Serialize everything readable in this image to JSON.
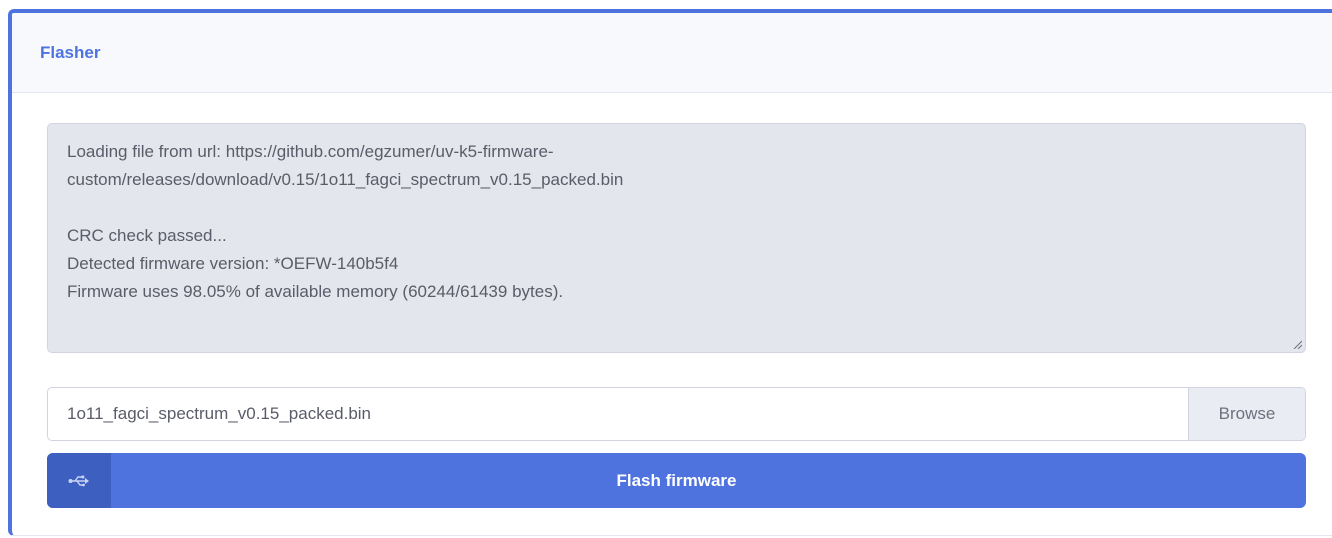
{
  "card": {
    "title": "Flasher"
  },
  "log": {
    "lines": [
      "Loading file from url: https://github.com/egzumer/uv-k5-firmware-",
      "custom/releases/download/v0.15/1o11_fagci_spectrum_v0.15_packed.bin",
      "",
      "CRC check passed...",
      "Detected firmware version: *OEFW-140b5f4",
      "Firmware uses 98.05% of available memory (60244/61439 bytes)."
    ]
  },
  "file_input": {
    "value": "1o11_fagci_spectrum_v0.15_packed.bin",
    "browse_label": "Browse"
  },
  "flash_button": {
    "label": "Flash firmware",
    "icon": "usb-icon"
  },
  "colors": {
    "accent": "#4e73df",
    "log_background": "#e3e6ec"
  }
}
